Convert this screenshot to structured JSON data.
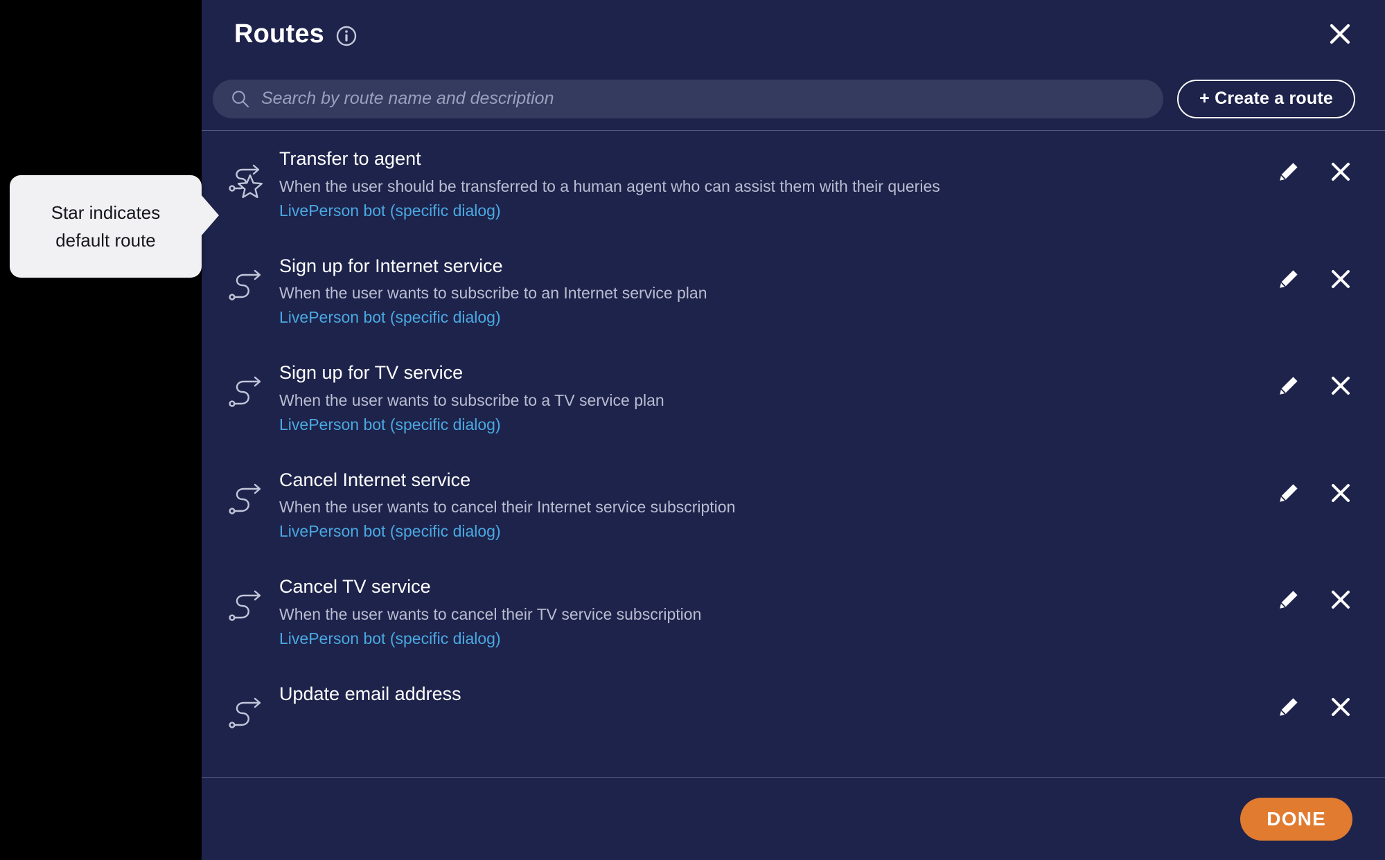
{
  "header": {
    "title": "Routes",
    "info_icon": "info-circle-icon",
    "close_icon": "close-icon"
  },
  "search": {
    "placeholder": "Search by route name and description",
    "value": "",
    "icon": "search-icon"
  },
  "toolbar": {
    "create_label": "+ Create a route"
  },
  "callout": {
    "line1": "Star indicates",
    "line2": "default route"
  },
  "routes": [
    {
      "name": "Transfer to agent",
      "description": "When the user should be transferred to a human agent who can assist them with their queries",
      "target": "LivePerson bot (specific dialog)",
      "is_default": true,
      "icon": "route-star-icon"
    },
    {
      "name": "Sign up for Internet service",
      "description": "When the user wants to subscribe to an Internet service plan",
      "target": "LivePerson bot (specific dialog)",
      "is_default": false,
      "icon": "route-icon"
    },
    {
      "name": "Sign up for TV service",
      "description": "When the user wants to subscribe to a TV service plan",
      "target": "LivePerson bot (specific dialog)",
      "is_default": false,
      "icon": "route-icon"
    },
    {
      "name": "Cancel Internet service",
      "description": "When the user wants to cancel their Internet service subscription",
      "target": "LivePerson bot (specific dialog)",
      "is_default": false,
      "icon": "route-icon"
    },
    {
      "name": "Cancel TV service",
      "description": "When the user wants to cancel their TV service subscription",
      "target": "LivePerson bot (specific dialog)",
      "is_default": false,
      "icon": "route-icon"
    },
    {
      "name": "Update email address",
      "description": "",
      "target": "",
      "is_default": false,
      "icon": "route-icon"
    }
  ],
  "row_actions": {
    "edit_icon": "pencil-icon",
    "delete_icon": "close-icon"
  },
  "footer": {
    "done_label": "DONE"
  },
  "colors": {
    "panel_background": "#1e234b",
    "backdrop": "#000000",
    "search_field": "#343b5f",
    "link": "#4aa9e2",
    "accent_done": "#e07b30",
    "divider": "#545b7d",
    "callout_background": "#f1f1f3"
  }
}
